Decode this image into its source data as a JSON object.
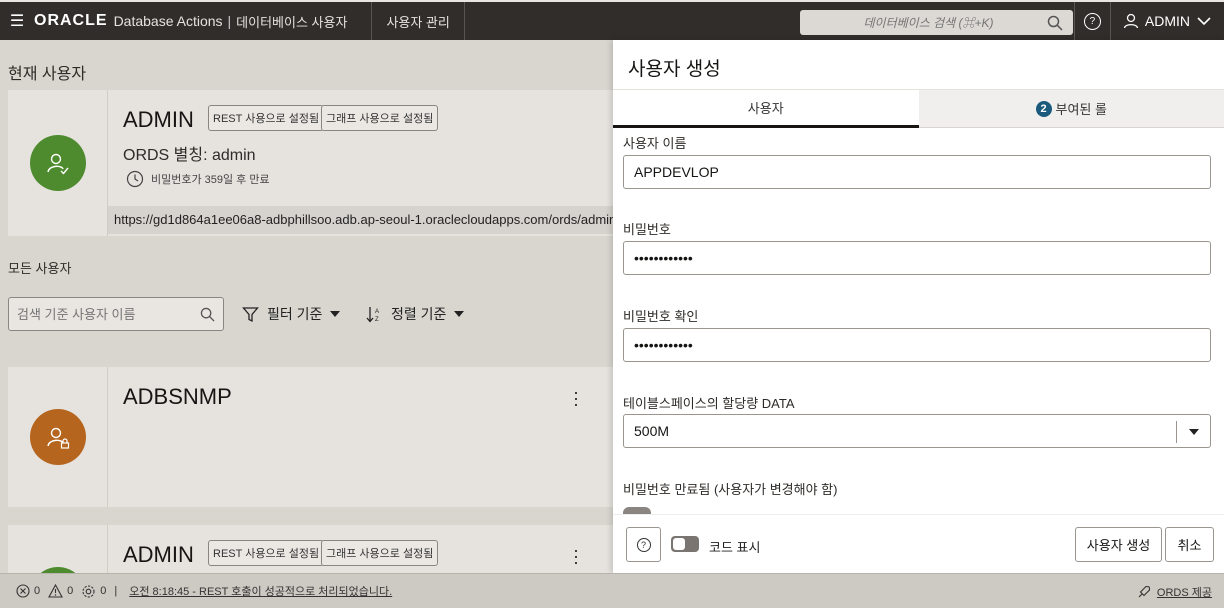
{
  "header": {
    "logo": "ORACLE",
    "app": "Database Actions",
    "separator": "|",
    "section": "데이터베이스 사용자",
    "nav_link": "사용자 관리",
    "search_placeholder": "데이터베이스 검색 (⌘+K)",
    "help": "?",
    "user": "ADMIN"
  },
  "left": {
    "current_heading": "현재 사용자",
    "current_user": {
      "name": "ADMIN",
      "badge_rest": "REST 사용으로 설정됨",
      "badge_graph": "그래프 사용으로 설정됨",
      "alias": "ORDS 별칭: admin",
      "expire": "비밀번호가 359일 후 만료",
      "url": "https://gd1d864a1ee06a8-adbphillsoo.adb.ap-seoul-1.oraclecloudapps.com/ords/admin/"
    },
    "all_heading": "모든 사용자",
    "search_placeholder": "검색 기준 사용자 이름",
    "filter_label": "필터 기준",
    "sort_label": "정렬 기준",
    "users": [
      {
        "name": "ADBSNMP"
      },
      {
        "name": "ADMIN",
        "badge_rest": "REST 사용으로 설정됨",
        "badge_graph": "그래프 사용으로 설정됨"
      }
    ],
    "avatar_colors": {
      "current": "#4e8b2e",
      "locked": "#b5651d"
    }
  },
  "panel": {
    "title": "사용자 생성",
    "tabs": [
      {
        "label": "사용자"
      },
      {
        "step": "2",
        "label": "부여된 롤"
      }
    ],
    "fields": {
      "username_label": "사용자 이름",
      "username_value": "APPDEVLOP",
      "password_label": "비밀번호",
      "password_value": "••••••••••••",
      "confirm_label": "비밀번호 확인",
      "confirm_value": "••••••••••••",
      "quota_label": "테이블스페이스의 할당량 DATA",
      "quota_value": "500M",
      "expired_label": "비밀번호 만료됨 (사용자가 변경해야 함)"
    },
    "footer": {
      "help": "?",
      "show_code": "코드 표시",
      "create_button": "사용자 생성",
      "cancel_button": "취소"
    }
  },
  "status": {
    "errors": "0",
    "warnings": "0",
    "settings_count": "0",
    "sep": "|",
    "message": "오전 8:18:45 - REST 호출이 성공적으로 처리되었습니다.",
    "ords": "ORDS 제공"
  }
}
